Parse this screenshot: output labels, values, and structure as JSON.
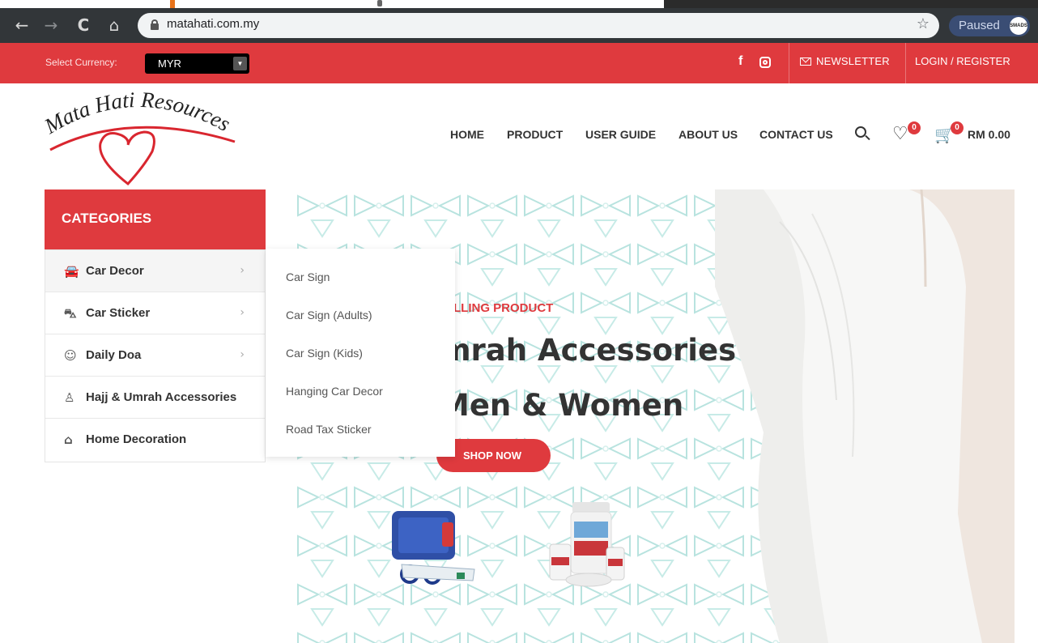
{
  "browser": {
    "url": "matahati.com.my",
    "profile_status": "Paused",
    "profile_avatar_text": "SMADS"
  },
  "topbar": {
    "currency_label": "Select Currency:",
    "currency_value": "MYR",
    "newsletter_label": "NEWSLETTER",
    "login_label": "LOGIN / REGISTER"
  },
  "header": {
    "logo_text": "Mata Hati Resources",
    "nav": [
      "HOME",
      "PRODUCT",
      "USER GUIDE",
      "ABOUT US",
      "CONTACT US"
    ],
    "wishlist_count": "0",
    "cart_count": "0",
    "cart_total": "RM 0.00"
  },
  "categories": {
    "title": "CATEGORIES",
    "items": [
      {
        "label": "Car Decor",
        "icon": "car-icon",
        "has_submenu": true
      },
      {
        "label": "Car Sticker",
        "icon": "sticker-icon",
        "has_submenu": true
      },
      {
        "label": "Daily Doa",
        "icon": "doa-icon",
        "has_submenu": true
      },
      {
        "label": "Hajj & Umrah Accessories",
        "icon": "umrah-icon",
        "has_submenu": false
      },
      {
        "label": "Home Decoration",
        "icon": "home-decor-icon",
        "has_submenu": false
      }
    ]
  },
  "submenu": {
    "items": [
      "Car Sign",
      "Car Sign (Adults)",
      "Car Sign (Kids)",
      "Hanging Car Decor",
      "Road Tax Sticker"
    ]
  },
  "hero": {
    "kicker": "SELLING PRODUCT",
    "title_line1": "mrah Accessories",
    "title_line2": "Men & Women",
    "cta_label": "SHOP NOW"
  },
  "colors": {
    "brand_red": "#df3a3e",
    "chrome_dark": "#323639",
    "text_dark": "#333333"
  }
}
